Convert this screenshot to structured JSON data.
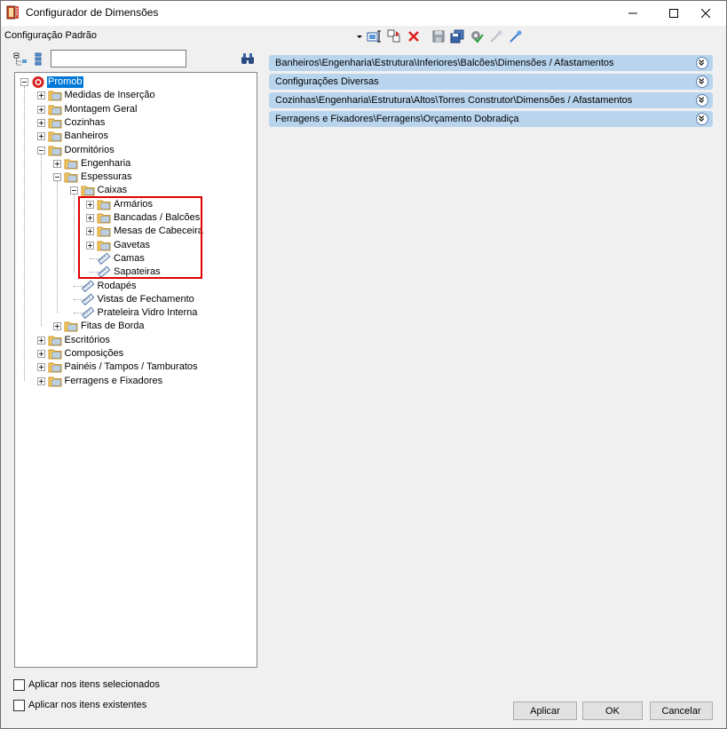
{
  "window": {
    "title": "Configurador de Dimensões",
    "icon": "ruler-book-icon"
  },
  "toolbar": {
    "config_name": "Configuração Padrão",
    "icons": [
      "new-config-icon",
      "copy-config-icon",
      "delete-icon",
      "save-icon",
      "save-all-icon",
      "apply-config-icon",
      "collapse-icon",
      "expand-icon"
    ]
  },
  "tree": {
    "search_value": "",
    "nodes": [
      {
        "label": "Promob",
        "selected": true
      },
      {
        "label": "Medidas de Inserção"
      },
      {
        "label": "Montagem Geral"
      },
      {
        "label": "Cozinhas"
      },
      {
        "label": "Banheiros"
      },
      {
        "label": "Dormitórios"
      },
      {
        "label": "Engenharia"
      },
      {
        "label": "Espessuras"
      },
      {
        "label": "Caixas"
      },
      {
        "label": "Armários"
      },
      {
        "label": "Bancadas / Balcões"
      },
      {
        "label": "Mesas de Cabeceira"
      },
      {
        "label": "Gavetas"
      },
      {
        "label": "Camas"
      },
      {
        "label": "Sapateiras"
      },
      {
        "label": "Rodapés"
      },
      {
        "label": "Vistas de Fechamento"
      },
      {
        "label": "Prateleira Vidro Interna"
      },
      {
        "label": "Fitas de Borda"
      },
      {
        "label": "Escritórios"
      },
      {
        "label": "Composições"
      },
      {
        "label": "Painéis / Tampos / Tamburatos"
      },
      {
        "label": "Ferragens e Fixadores"
      }
    ]
  },
  "panels": [
    {
      "title": "Banheiros\\Engenharia\\Estrutura\\Inferiores\\Balcões\\Dimensões / Afastamentos"
    },
    {
      "title": "Configurações Diversas"
    },
    {
      "title": "Cozinhas\\Engenharia\\Estrutura\\Altos\\Torres Construtor\\Dimensões / Afastamentos"
    },
    {
      "title": "Ferragens e Fixadores\\Ferragens\\Orçamento Dobradiça"
    }
  ],
  "options": {
    "apply_selected": "Aplicar nos itens selecionados",
    "apply_existing": "Aplicar nos itens existentes"
  },
  "buttons": {
    "apply": "Aplicar",
    "ok": "OK",
    "cancel": "Cancelar"
  },
  "colors": {
    "selection": "#0078d7",
    "panel_header": "#b9d5ee",
    "highlight": "#e00000"
  }
}
